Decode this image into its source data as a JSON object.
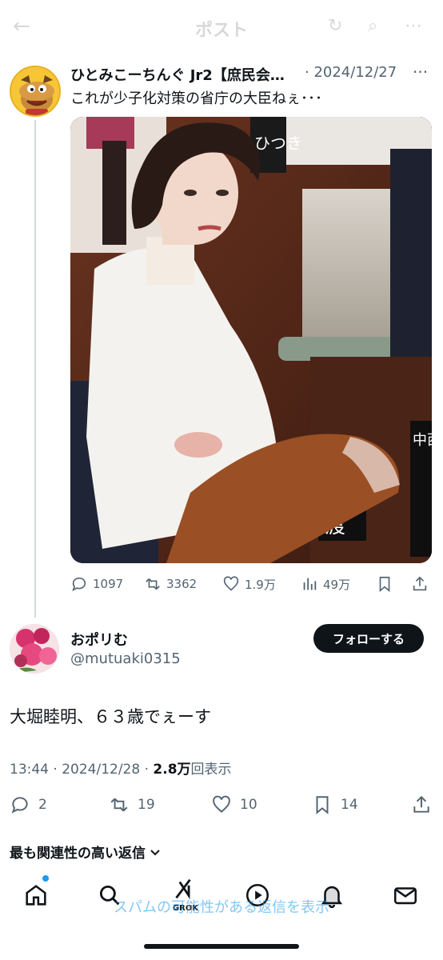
{
  "header": {
    "title": "ポスト"
  },
  "parent_tweet": {
    "author": "ひとみこーちんぐ Jr2【庶民会…",
    "date": "· 2024/12/27",
    "more": "···",
    "text": "これが少子化対策の省庁の大臣ねぇ･･･",
    "placard_upper": "ひつき",
    "placard_lower": "渡",
    "placard_right": "中西村",
    "stats": {
      "replies": "1097",
      "reposts": "3362",
      "likes": "1.9万",
      "views": "49万"
    }
  },
  "main_tweet": {
    "author": "おポリむ",
    "handle": "@mutuaki0315",
    "follow_label": "フォローする",
    "text": "大堀睦明、６３歳でぇーす",
    "time": "13:44 · 2024/12/28 · ",
    "views_count": "2.8万",
    "views_label": "回表示",
    "stats": {
      "replies": "2",
      "reposts": "19",
      "likes": "10",
      "bookmarks": "14"
    }
  },
  "replies_section": {
    "sort_label": "最も関連性の高い返信",
    "spam_link": "スパムの可能性がある返信を表示"
  },
  "nav": {
    "grok_label": "GROK"
  },
  "colors": {
    "accent": "#1d9bf0",
    "text": "#0f1419",
    "muted": "#536471",
    "follow_bg": "#0f1419"
  }
}
